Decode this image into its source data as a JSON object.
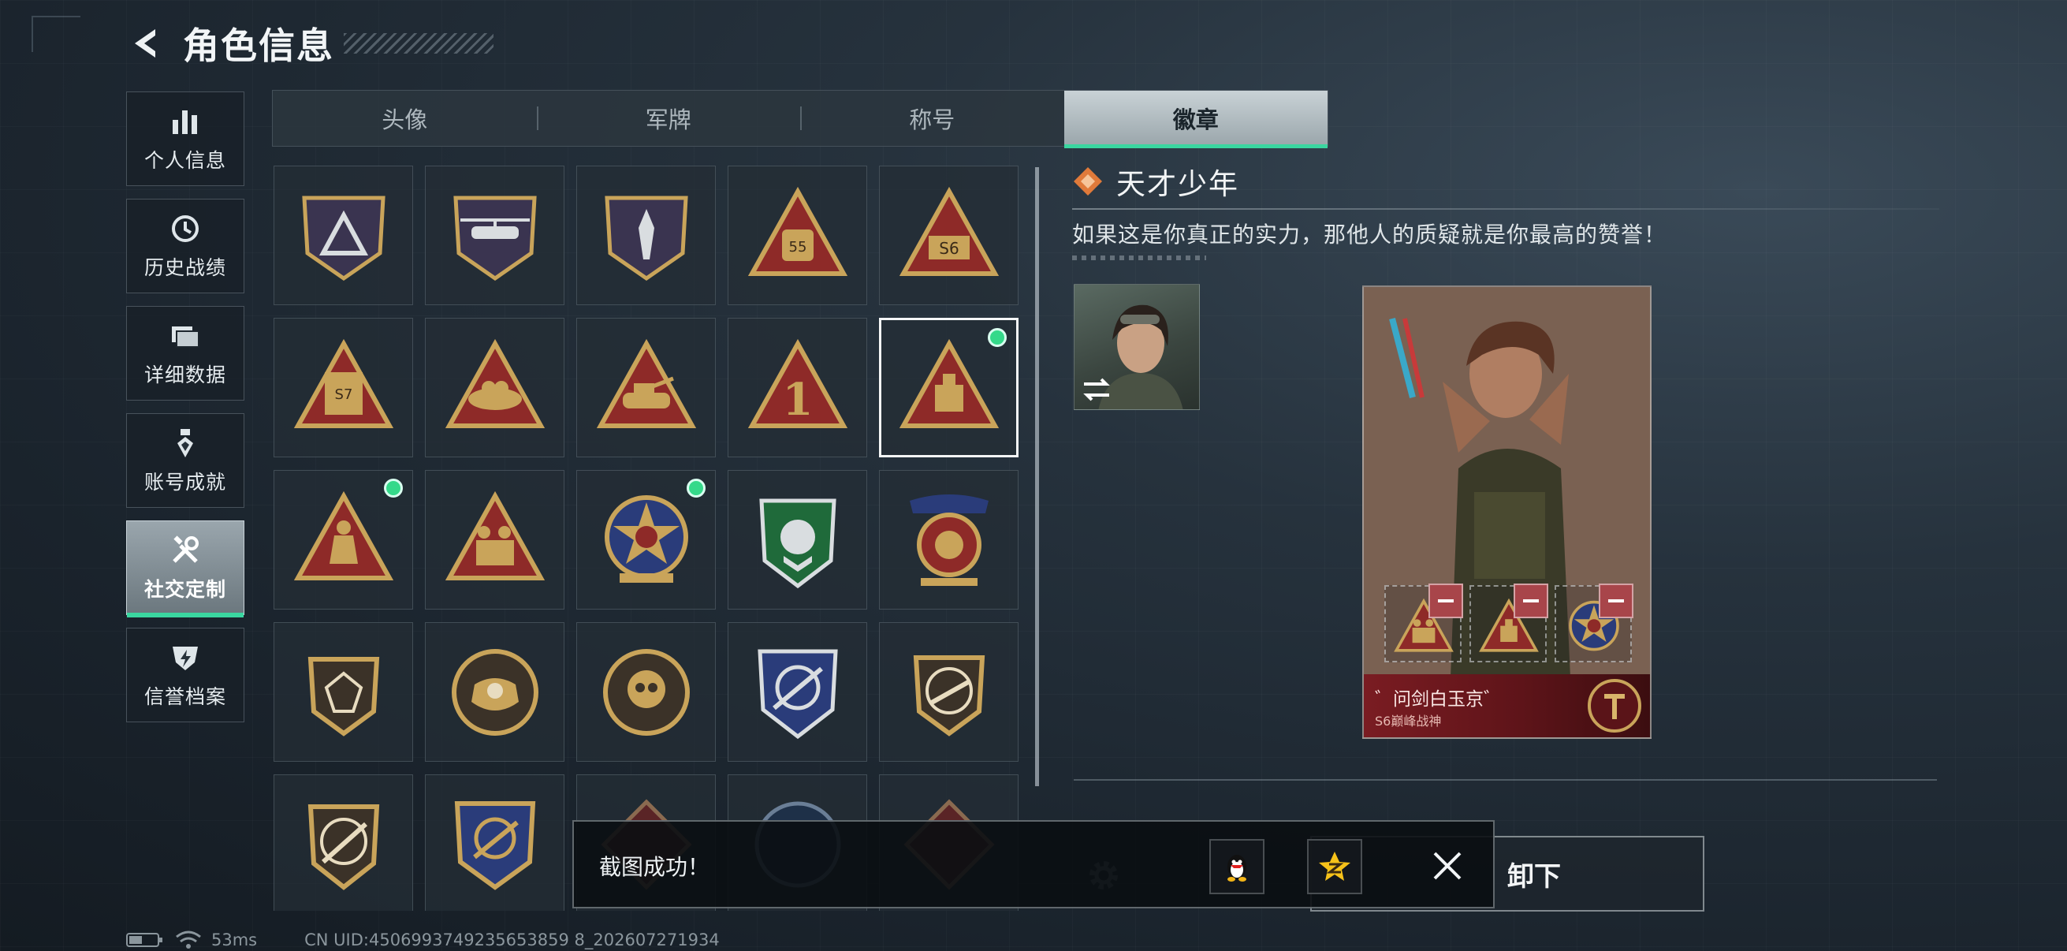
{
  "header": {
    "title": "角色信息"
  },
  "sidebar": {
    "items": [
      {
        "label": "个人信息",
        "icon": "bar-chart-icon",
        "active": false
      },
      {
        "label": "历史战绩",
        "icon": "history-clock-icon",
        "active": false
      },
      {
        "label": "详细数据",
        "icon": "folder-icon",
        "active": false
      },
      {
        "label": "账号成就",
        "icon": "medal-icon",
        "active": false
      },
      {
        "label": "社交定制",
        "icon": "tools-icon",
        "active": true
      },
      {
        "label": "信誉档案",
        "icon": "shield-bolt-icon",
        "active": false
      }
    ]
  },
  "tabs": [
    {
      "label": "头像",
      "active": false
    },
    {
      "label": "军牌",
      "active": false
    },
    {
      "label": "称号",
      "active": false
    },
    {
      "label": "徽章",
      "active": true
    }
  ],
  "badges": {
    "badge_labels": {
      "b4": "55",
      "b5": "S6",
      "b6": "S7",
      "b9": "1"
    },
    "selected_index": 9,
    "new_indices": [
      9,
      10,
      12
    ]
  },
  "detail": {
    "title": "天才少年",
    "description": "如果这是你真正的实力，那他人的质疑就是你最高的赞誉！"
  },
  "card": {
    "player_name": "゛问剑白玉京゛",
    "player_rank": "S6巅峰战神"
  },
  "actions": {
    "unload_label": "卸下"
  },
  "toast": {
    "message": "截图成功！"
  },
  "status": {
    "ping": "53ms",
    "uid": "CN UID:4506993749235653859 8_202607271934"
  },
  "colors": {
    "accent": "#3ad6a0",
    "new_dot": "#35d98a",
    "badge_red": "#8e2a28",
    "badge_gold": "#c9a45a"
  }
}
